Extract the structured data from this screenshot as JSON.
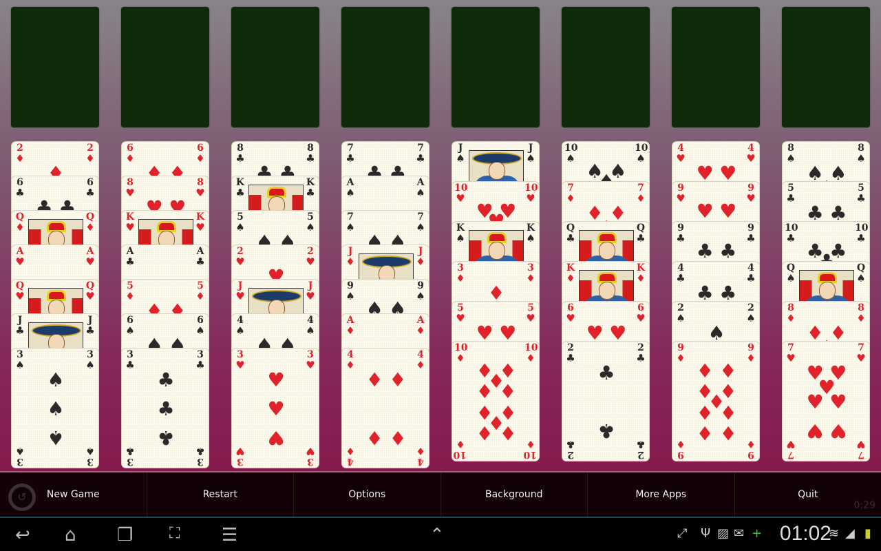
{
  "colors": {
    "red": "#e0222a",
    "black": "#2a2a2a",
    "freecell": "#0f2a0c",
    "menu_bg": "#120208"
  },
  "free_cells": [
    null,
    null,
    null,
    null,
    null,
    null,
    null,
    null
  ],
  "tableau": [
    [
      "2♦",
      "6♣",
      "Q♦",
      "A♥",
      "Q♥",
      "J♣",
      "3♠"
    ],
    [
      "6♦",
      "8♥",
      "K♥",
      "A♣",
      "5♦",
      "6♠",
      "3♣"
    ],
    [
      "8♣",
      "K♣",
      "5♠",
      "2♥",
      "J♥",
      "4♠",
      "3♥"
    ],
    [
      "7♣",
      "A♠",
      "7♠",
      "J♦",
      "9♠",
      "A♦",
      "4♦"
    ],
    [
      "J♠",
      "10♥",
      "K♠",
      "3♦",
      "5♥",
      "10♦"
    ],
    [
      "10♠",
      "7♦",
      "Q♣",
      "K♦",
      "6♥",
      "2♣"
    ],
    [
      "4♥",
      "9♥",
      "9♣",
      "4♣",
      "2♠",
      "9♦"
    ],
    [
      "8♠",
      "5♣",
      "10♣",
      "Q♠",
      "8♦",
      "7♥"
    ]
  ],
  "menu": {
    "items": [
      "New Game",
      "Restart",
      "Options",
      "Background",
      "More Apps",
      "Quit"
    ],
    "timer": "0:29",
    "history_icon": "history-icon"
  },
  "status_bar": {
    "clock": "01:02",
    "nav_icons": [
      "back-icon",
      "home-icon",
      "recent-apps-icon",
      "screenshot-icon",
      "menu-icon",
      "up-chevron-icon"
    ],
    "status_icons": [
      "fullscreen-icon",
      "usb-icon",
      "gallery-icon",
      "email-icon",
      "plus-icon",
      "wifi-icon",
      "signal-icon",
      "battery-icon"
    ]
  }
}
